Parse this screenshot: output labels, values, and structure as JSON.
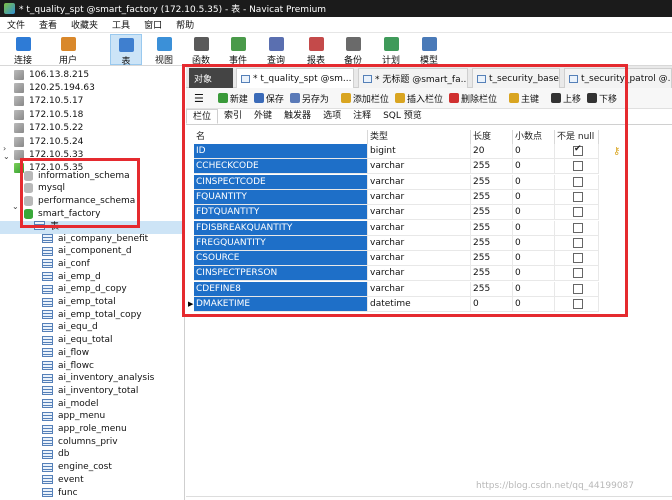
{
  "window": {
    "title": "* t_quality_spt @smart_factory (172.10.5.35) - 表 - Navicat Premium"
  },
  "menu": [
    "文件",
    "查看",
    "收藏夹",
    "工具",
    "窗口",
    "帮助"
  ],
  "toolbar": [
    {
      "label": "连接",
      "icon": "plug-icon",
      "color": "#2e7bd6"
    },
    {
      "label": "用户",
      "icon": "user-icon",
      "color": "#d9882b"
    },
    {
      "label": "表",
      "icon": "table-icon",
      "color": "#3f7fcf",
      "active": true
    },
    {
      "label": "视图",
      "icon": "view-icon",
      "color": "#3b90d8"
    },
    {
      "label": "函数",
      "icon": "function-icon",
      "color": "#5a5a5a"
    },
    {
      "label": "事件",
      "icon": "event-icon",
      "color": "#4a9a4a"
    },
    {
      "label": "查询",
      "icon": "query-icon",
      "color": "#5a6fb0"
    },
    {
      "label": "报表",
      "icon": "report-icon",
      "color": "#c44a4a"
    },
    {
      "label": "备份",
      "icon": "backup-icon",
      "color": "#6a6a6a"
    },
    {
      "label": "计划",
      "icon": "schedule-icon",
      "color": "#3f9a5a"
    },
    {
      "label": "模型",
      "icon": "model-icon",
      "color": "#4a7ab8"
    }
  ],
  "sidebar": {
    "servers": [
      "106.13.8.215",
      "120.25.194.63",
      "172.10.5.17",
      "172.10.5.18",
      "172.10.5.22",
      "172.10.5.24",
      "172.10.5.33",
      "172.10.5.35"
    ],
    "databases": [
      "information_schema",
      "mysql",
      "performance_schema",
      "smart_factory"
    ],
    "tables_node": "表",
    "tables": [
      "ai_company_benefit",
      "ai_component_d",
      "ai_conf",
      "ai_emp_d",
      "ai_emp_d_copy",
      "ai_emp_total",
      "ai_emp_total_copy",
      "ai_equ_d",
      "ai_equ_total",
      "ai_flow",
      "ai_flowc",
      "ai_inventory_analysis",
      "ai_inventory_total",
      "ai_model",
      "app_menu",
      "app_role_menu",
      "columns_priv",
      "db",
      "engine_cost",
      "event",
      "func"
    ]
  },
  "tabs": [
    {
      "label": "对象",
      "style": "dark"
    },
    {
      "label": "* t_quality_spt @sm...",
      "style": "active"
    },
    {
      "label": "* 无标题 @smart_fa...",
      "style": "normal"
    },
    {
      "label": "t_security_base @s...",
      "style": "normal"
    },
    {
      "label": "t_security_patrol @...",
      "style": "normal"
    }
  ],
  "editor_toolbar": [
    {
      "label": "新建",
      "icon": "new-icon",
      "color": "#3a9a3a"
    },
    {
      "label": "保存",
      "icon": "save-icon",
      "color": "#3a6ab8"
    },
    {
      "label": "另存为",
      "icon": "save-as-icon",
      "color": "#5a7ab8"
    },
    {
      "label": "添加栏位",
      "icon": "add-column-icon",
      "color": "#d9a521"
    },
    {
      "label": "插入栏位",
      "icon": "insert-column-icon",
      "color": "#d9a521"
    },
    {
      "label": "删除栏位",
      "icon": "delete-column-icon",
      "color": "#d03030"
    },
    {
      "label": "主键",
      "icon": "primary-key-icon",
      "color": "#d9a521"
    },
    {
      "label": "上移",
      "icon": "move-up-icon",
      "color": "#333333"
    },
    {
      "label": "下移",
      "icon": "move-down-icon",
      "color": "#333333"
    }
  ],
  "subtabs": [
    "栏位",
    "索引",
    "外键",
    "触发器",
    "选项",
    "注释",
    "SQL 预览"
  ],
  "grid": {
    "headers": {
      "name": "名",
      "type": "类型",
      "length": "长度",
      "decimals": "小数点",
      "not_null": "不是 null"
    },
    "rows": [
      {
        "name": "ID",
        "type": "bigint",
        "length": "20",
        "decimals": "0",
        "not_null": true,
        "primary_key": true
      },
      {
        "name": "CCHECKCODE",
        "type": "varchar",
        "length": "255",
        "decimals": "0",
        "not_null": false
      },
      {
        "name": "CINSPECTCODE",
        "type": "varchar",
        "length": "255",
        "decimals": "0",
        "not_null": false
      },
      {
        "name": "FQUANTITY",
        "type": "varchar",
        "length": "255",
        "decimals": "0",
        "not_null": false
      },
      {
        "name": "FDTQUANTITY",
        "type": "varchar",
        "length": "255",
        "decimals": "0",
        "not_null": false
      },
      {
        "name": "FDISBREAKQUANTITY",
        "type": "varchar",
        "length": "255",
        "decimals": "0",
        "not_null": false
      },
      {
        "name": "FREGQUANTITY",
        "type": "varchar",
        "length": "255",
        "decimals": "0",
        "not_null": false
      },
      {
        "name": "CSOURCE",
        "type": "varchar",
        "length": "255",
        "decimals": "0",
        "not_null": false
      },
      {
        "name": "CINSPECTPERSON",
        "type": "varchar",
        "length": "255",
        "decimals": "0",
        "not_null": false
      },
      {
        "name": "CDEFINE8",
        "type": "varchar",
        "length": "255",
        "decimals": "0",
        "not_null": false
      },
      {
        "name": "DMAKETIME",
        "type": "datetime",
        "length": "0",
        "decimals": "0",
        "not_null": false,
        "current": true
      }
    ]
  },
  "colors": {
    "highlight_box": "#e52a2f",
    "selected_cell": "#1e6fc8",
    "title_bar": "#1b1b1b"
  },
  "watermark": "https://blog.csdn.net/qq_44199087"
}
